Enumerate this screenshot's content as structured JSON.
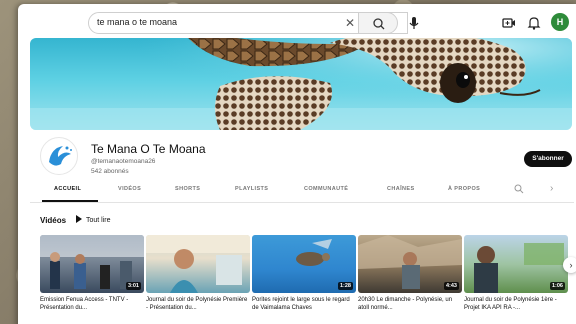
{
  "search": {
    "value": "te mana o te moana",
    "clear_icon": "close-icon",
    "search_icon": "search-icon"
  },
  "topbar": {
    "avatar_letter": "H",
    "avatar_color": "#2e8b3a"
  },
  "channel": {
    "name": "Te Mana O Te Moana",
    "handle": "@temanaotemoana26",
    "subscribers": "542 abonnés",
    "subscribe_label": "S'abonner"
  },
  "tabs": [
    {
      "label": "ACCUEIL",
      "active": true
    },
    {
      "label": "VIDÉOS",
      "active": false
    },
    {
      "label": "SHORTS",
      "active": false
    },
    {
      "label": "PLAYLISTS",
      "active": false
    },
    {
      "label": "COMMUNAUTÉ",
      "active": false
    },
    {
      "label": "CHAÎNES",
      "active": false
    },
    {
      "label": "À PROPOS",
      "active": false
    }
  ],
  "section": {
    "title": "Vidéos",
    "play_all": "Tout lire"
  },
  "videos": [
    {
      "title": "Emission Fenua Access - TNTV - Présentation du...",
      "duration": "3:01"
    },
    {
      "title": "Journal du soir de Polynésie Première - Présentation du...",
      "duration": ""
    },
    {
      "title": "Porites rejoint le large sous le regard de Vaimalama Chaves",
      "duration": "1:28"
    },
    {
      "title": "20h30 Le dimanche - Polynésie, un atoll normé...",
      "duration": "4:43"
    },
    {
      "title": "Journal du soir de Polynésie 1ère - Projet IKA API RA -...",
      "duration": "1:06"
    }
  ],
  "colors": {
    "subscribe_bg": "#0f0f0f",
    "banner_water": "#35b5d0",
    "logo_blue": "#2a8fd8"
  }
}
